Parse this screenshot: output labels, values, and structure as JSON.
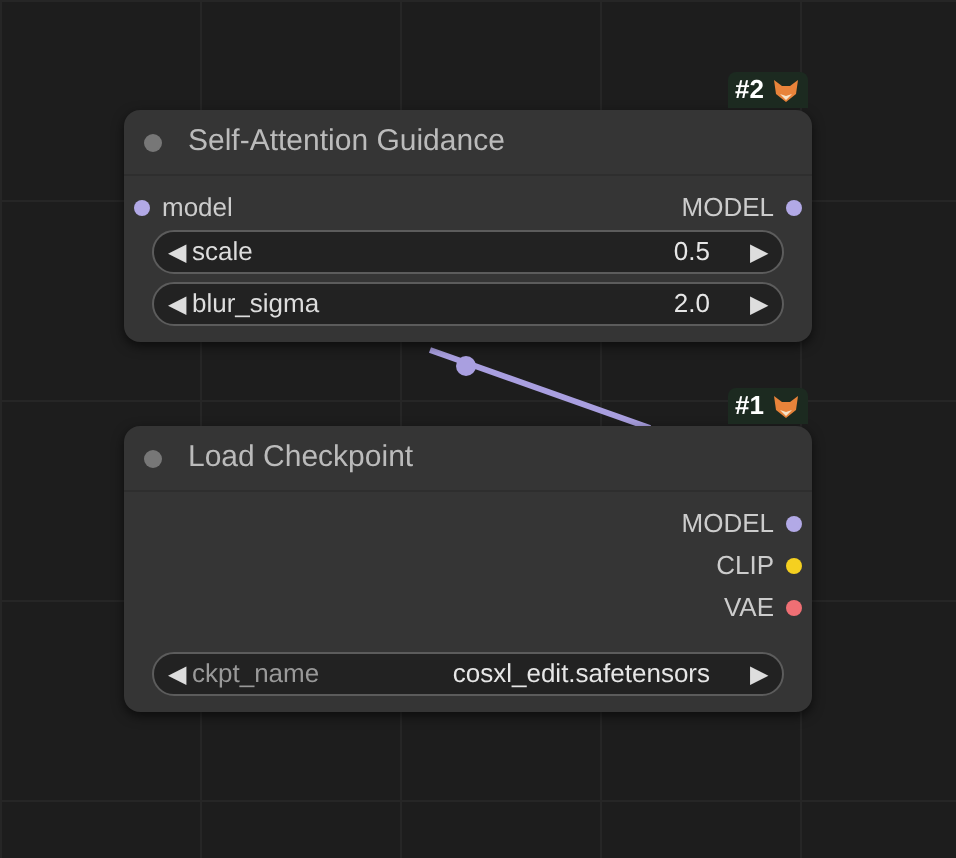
{
  "nodes": [
    {
      "badge": "#2",
      "title": "Self-Attention Guidance",
      "inputs": [
        {
          "label": "model",
          "color": "#b2a9e6"
        }
      ],
      "outputs": [
        {
          "label": "MODEL",
          "color": "#b2a9e6"
        }
      ],
      "widgets": [
        {
          "name": "scale",
          "value": "0.5",
          "decrement": "◀",
          "increment": "▶"
        },
        {
          "name": "blur_sigma",
          "value": "2.0",
          "decrement": "◀",
          "increment": "▶"
        }
      ]
    },
    {
      "badge": "#1",
      "title": "Load Checkpoint",
      "outputs": [
        {
          "label": "MODEL",
          "color": "#b2a9e6"
        },
        {
          "label": "CLIP",
          "color": "#f5d020"
        },
        {
          "label": "VAE",
          "color": "#ef6f74"
        }
      ],
      "widgets": [
        {
          "name": "ckpt_name",
          "value": "cosxl_edit.safetensors",
          "decrement": "◀",
          "increment": "▶"
        }
      ]
    }
  ]
}
